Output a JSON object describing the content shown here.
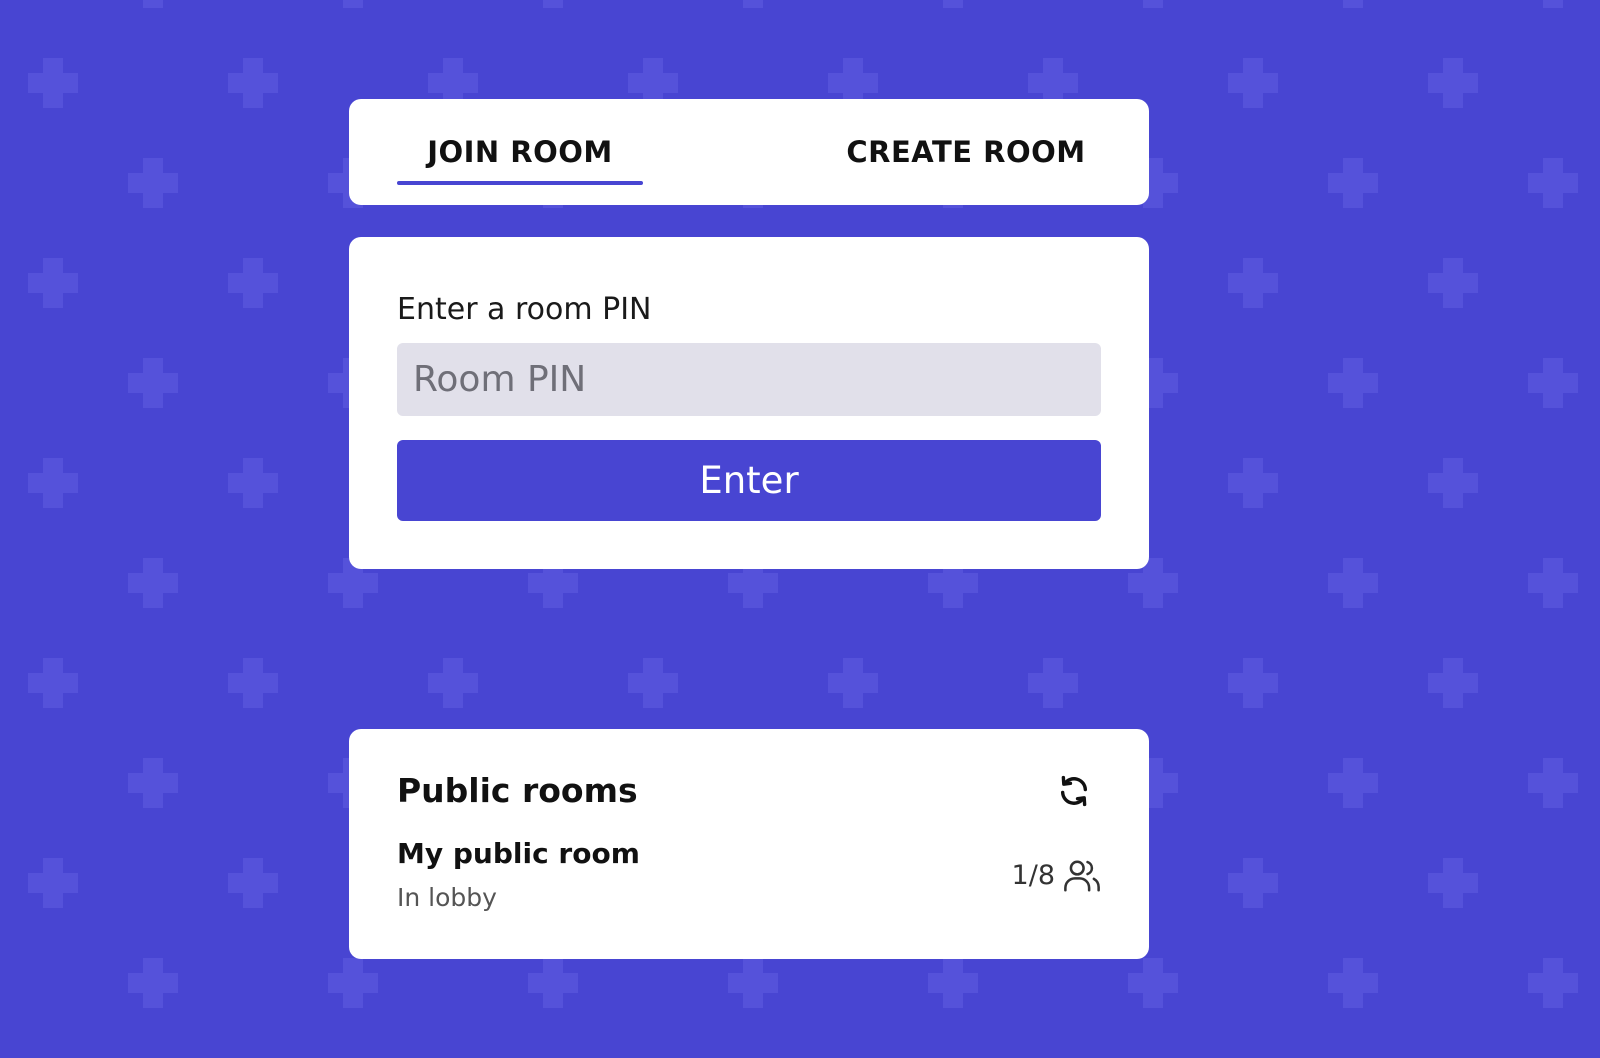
{
  "theme": {
    "background": "#4845D2",
    "pattern_color": "#5552DA",
    "accent": "#4845D2",
    "card": "#FFFFFF",
    "input_bg": "#E1E0EA"
  },
  "tabs": {
    "join_label": "JOIN ROOM",
    "create_label": "CREATE ROOM",
    "active": "join"
  },
  "join": {
    "label": "Enter a room PIN",
    "input_placeholder": "Room PIN",
    "input_value": "",
    "button_label": "Enter"
  },
  "public_rooms": {
    "title": "Public rooms",
    "refresh_icon": "refresh-icon",
    "rooms": [
      {
        "name": "My public room",
        "status": "In lobby",
        "players": "1/8",
        "icon": "users-icon"
      }
    ]
  }
}
